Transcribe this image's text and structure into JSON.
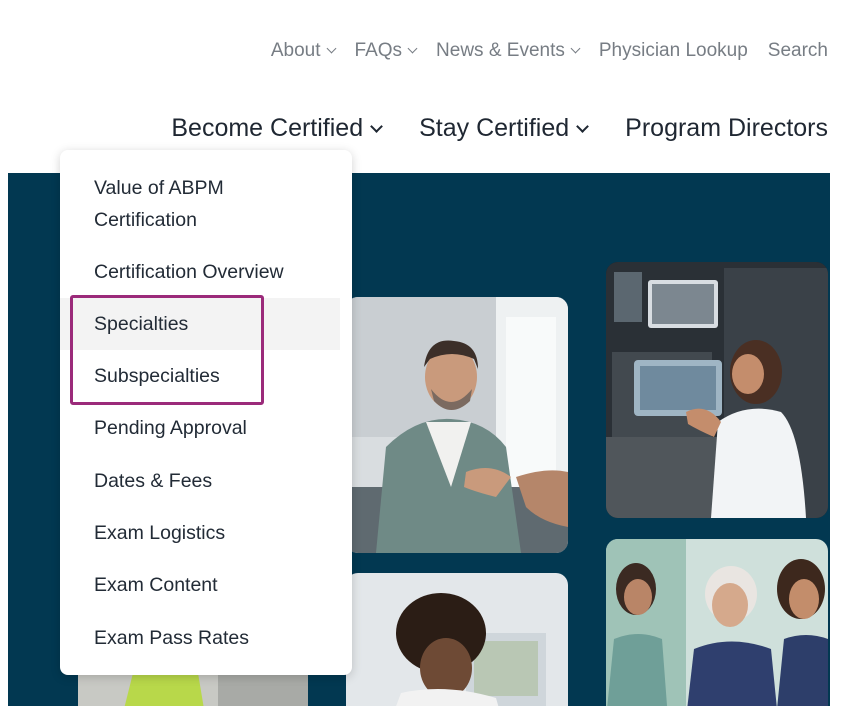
{
  "utility_nav": [
    {
      "label": "About",
      "has_dropdown": true
    },
    {
      "label": "FAQs",
      "has_dropdown": true
    },
    {
      "label": "News & Events",
      "has_dropdown": true
    },
    {
      "label": "Physician Lookup",
      "has_dropdown": false
    },
    {
      "label": "Search",
      "has_dropdown": false
    }
  ],
  "main_nav": [
    {
      "label": "Become Certified",
      "has_dropdown": true
    },
    {
      "label": "Stay Certified",
      "has_dropdown": true
    },
    {
      "label": "Program Directors",
      "has_dropdown": false
    }
  ],
  "dropdown": {
    "items": [
      "Value of ABPM\nCertification",
      "Certification Overview",
      "Specialties",
      "Subspecialties",
      "Pending Approval",
      "Dates & Fees",
      "Exam Logistics",
      "Exam Content",
      "Exam Pass Rates"
    ],
    "hovered_index": 2
  },
  "colors": {
    "hero_bg": "#023851",
    "highlight_border": "#9b2a7a",
    "nav_text": "#1f2732",
    "utility_text": "#777d84"
  }
}
